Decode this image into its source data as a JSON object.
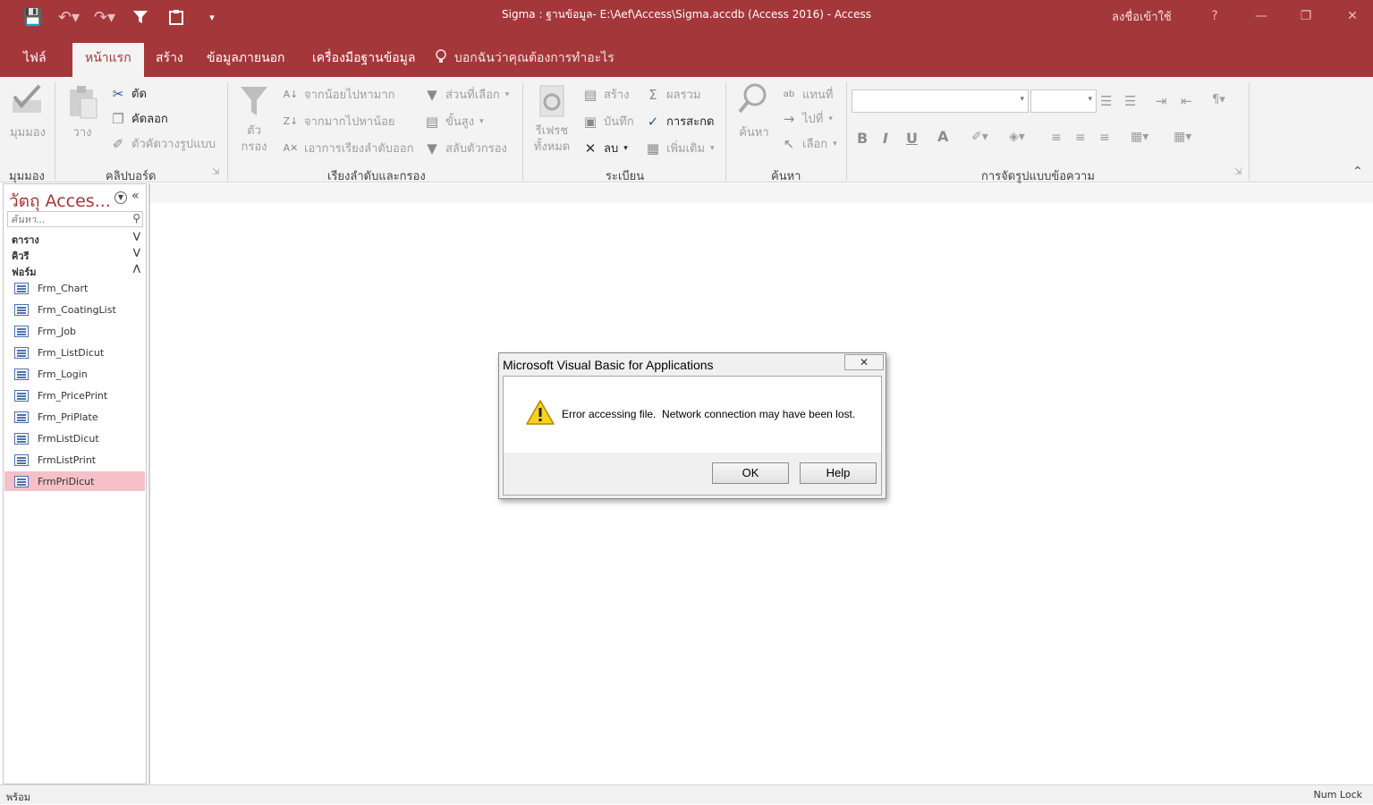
{
  "titlebar": {
    "title": "Sigma : ฐานข้อมูล- E:\\Aef\\Access\\Sigma.accdb (Access 2016)  -  Access",
    "signin": "ลงชื่อเข้าใช้",
    "help": "?",
    "minimize": "—",
    "restore": "❐",
    "close": "✕"
  },
  "tabs": {
    "file": "ไฟล์",
    "home": "หน้าแรก",
    "create": "สร้าง",
    "external": "ข้อมูลภายนอก",
    "dbtools": "เครื่องมือฐานข้อมูล",
    "tellme": "บอกฉันว่าคุณต้องการทำอะไร"
  },
  "ribbon": {
    "views": {
      "label": "มุมมอง",
      "group": "มุมมอง"
    },
    "clipboard": {
      "paste": "วาง",
      "cut": "ตัด",
      "copy": "คัดลอก",
      "format_painter": "ตัวคัดวางรูปแบบ",
      "group": "คลิปบอร์ด"
    },
    "sort": {
      "filter_line1": "ตัว",
      "filter_line2": "กรอง",
      "ascending": "จากน้อยไปหามาก",
      "descending": "จากมากไปหาน้อย",
      "remove_sort": "เอาการเรียงลำดับออก",
      "selection": "ส่วนที่เลือก",
      "advanced": "ขั้นสูง",
      "toggle_filter": "สลับตัวกรอง",
      "group": "เรียงลำดับและกรอง"
    },
    "records": {
      "refresh_line1": "รีเฟรช",
      "refresh_line2": "ทั้งหมด",
      "new": "สร้าง",
      "save": "บันทึก",
      "delete": "ลบ",
      "totals": "ผลรวม",
      "spelling": "การสะกด",
      "more": "เพิ่มเติม",
      "group": "ระเบียน"
    },
    "find": {
      "find": "ค้นหา",
      "replace": "แทนที่",
      "goto": "ไปที่",
      "select": "เลือก",
      "group": "ค้นหา"
    },
    "text_format": {
      "bold": "B",
      "italic": "I",
      "underline": "U",
      "font_color": "A",
      "group": "การจัดรูปแบบข้อความ"
    }
  },
  "nav": {
    "title": "วัตถุ Acces...",
    "search_placeholder": "ค้นหา...",
    "categories": [
      "ตาราง",
      "คิวรี",
      "ฟอร์ม"
    ],
    "forms": [
      "Frm_Chart",
      "Frm_CoatingList",
      "Frm_Job",
      "Frm_ListDicut",
      "Frm_Login",
      "Frm_PricePrint",
      "Frm_PriPlate",
      "FrmListDicut",
      "FrmListPrint",
      "FrmPriDicut"
    ]
  },
  "dialog": {
    "title": "Microsoft Visual Basic for Applications",
    "message": "Error accessing file.  Network connection may have been lost.",
    "ok": "OK",
    "help": "Help"
  },
  "status": {
    "left": "พร้อม",
    "right": "Num Lock"
  },
  "colors": {
    "accent": "#a4373a",
    "selected_item": "#f5c0c8"
  },
  "icons": [
    "save-icon",
    "undo-icon",
    "redo-icon",
    "filter-icon",
    "clipboard-icon",
    "customize-icon",
    "lightbulb-icon",
    "warning-icon",
    "form-icon",
    "search-icon"
  ]
}
